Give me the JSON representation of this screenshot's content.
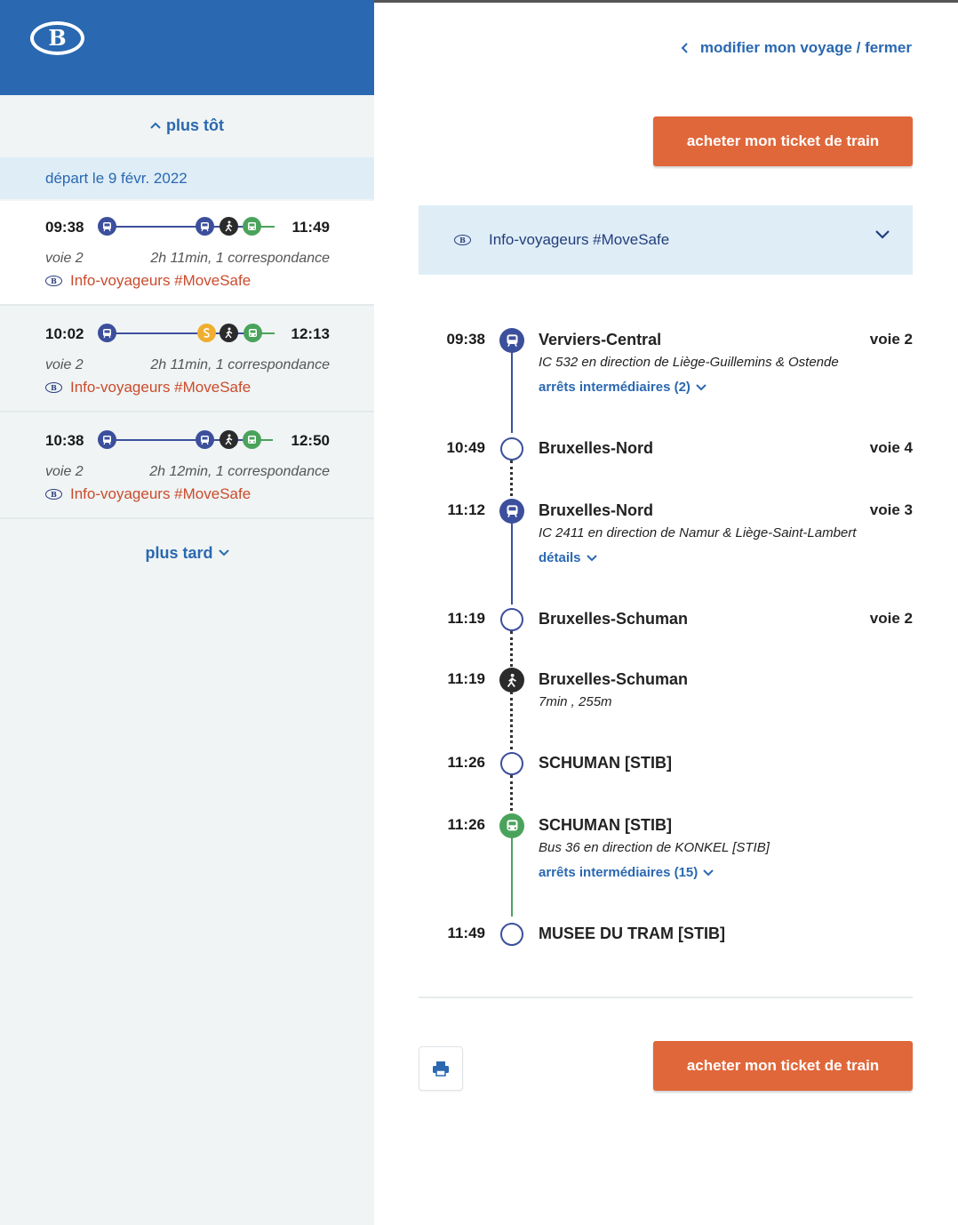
{
  "logo_text": "B",
  "colors": {
    "brand_blue": "#2a68b1",
    "train": "#3c4f9c",
    "bus": "#4aa35b",
    "walk": "#2b2b2b",
    "metro": "#f0ae31",
    "cta": "#e0673a",
    "alert_text": "#cb4b2c"
  },
  "sidebar": {
    "earlier_label": "plus tôt",
    "date_label": "départ le 9 févr. 2022",
    "later_label": "plus tard",
    "trips": [
      {
        "departure": "09:38",
        "arrival": "11:49",
        "platform": "voie 2",
        "duration": "2h 11min, 1 correspondance",
        "info": "Info-voyageurs #MoveSafe",
        "modes": [
          "train-icon",
          "train-icon",
          "walk-icon",
          "bus-icon"
        ]
      },
      {
        "departure": "10:02",
        "arrival": "12:13",
        "platform": "voie 2",
        "duration": "2h 11min, 1 correspondance",
        "info": "Info-voyageurs #MoveSafe",
        "modes": [
          "train-icon",
          "metro-icon",
          "walk-icon",
          "bus-icon"
        ]
      },
      {
        "departure": "10:38",
        "arrival": "12:50",
        "platform": "voie 2",
        "duration": "2h 12min, 1 correspondance",
        "info": "Info-voyageurs #MoveSafe",
        "modes": [
          "train-icon",
          "train-icon",
          "walk-icon",
          "bus-icon"
        ]
      }
    ]
  },
  "detail": {
    "modify_label": "modifier mon voyage / fermer",
    "buy_label": "acheter mon ticket de train",
    "info_label": "Info-voyageurs #MoveSafe",
    "stops": [
      {
        "time": "09:38",
        "name": "Verviers-Central",
        "platform": "voie 2",
        "sub": "IC 532 en direction de Liège-Guillemins & Ostende",
        "more": "arrêts intermédiaires (2)",
        "icon": "train-icon"
      },
      {
        "time": "10:49",
        "name": "Bruxelles-Nord",
        "platform": "voie 4",
        "icon": "stop-circle-icon"
      },
      {
        "time": "11:12",
        "name": "Bruxelles-Nord",
        "platform": "voie 3",
        "sub": "IC 2411 en direction de Namur & Liège-Saint-Lambert",
        "more": "détails",
        "icon": "train-icon"
      },
      {
        "time": "11:19",
        "name": "Bruxelles-Schuman",
        "platform": "voie 2",
        "icon": "stop-circle-icon"
      },
      {
        "time": "11:19",
        "name": "Bruxelles-Schuman",
        "sub": "7min , 255m",
        "icon": "walk-icon"
      },
      {
        "time": "11:26",
        "name": "SCHUMAN [STIB]",
        "icon": "stop-circle-icon"
      },
      {
        "time": "11:26",
        "name": "SCHUMAN [STIB]",
        "sub": "Bus 36 en direction de KONKEL [STIB]",
        "more": "arrêts intermédiaires (15)",
        "icon": "bus-icon"
      },
      {
        "time": "11:49",
        "name": "MUSEE DU TRAM [STIB]",
        "icon": "stop-circle-icon"
      }
    ]
  }
}
